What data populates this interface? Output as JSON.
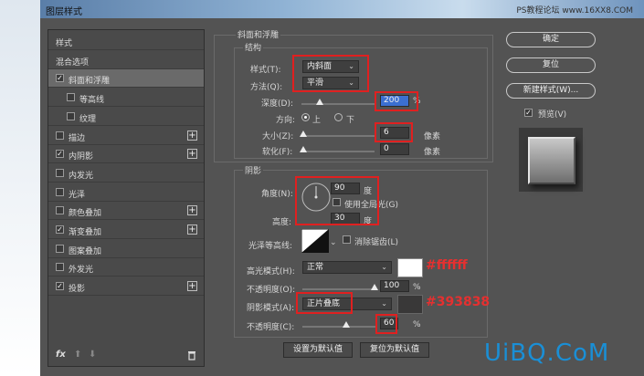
{
  "window": {
    "title": "图层样式",
    "watermark": "PS教程论坛 www.16XX8.COM"
  },
  "styles_list": [
    {
      "label": "样式",
      "checkbox": false,
      "plus": false,
      "checked": false,
      "indent": 0,
      "selected": false
    },
    {
      "label": "混合选项",
      "checkbox": false,
      "plus": false,
      "checked": false,
      "indent": 0,
      "selected": false
    },
    {
      "label": "斜面和浮雕",
      "checkbox": true,
      "plus": false,
      "checked": true,
      "indent": 0,
      "selected": true
    },
    {
      "label": "等高线",
      "checkbox": true,
      "plus": false,
      "checked": false,
      "indent": 1,
      "selected": false
    },
    {
      "label": "纹理",
      "checkbox": true,
      "plus": false,
      "checked": false,
      "indent": 1,
      "selected": false
    },
    {
      "label": "描边",
      "checkbox": true,
      "plus": true,
      "checked": false,
      "indent": 0,
      "selected": false
    },
    {
      "label": "内阴影",
      "checkbox": true,
      "plus": true,
      "checked": true,
      "indent": 0,
      "selected": false
    },
    {
      "label": "内发光",
      "checkbox": true,
      "plus": false,
      "checked": false,
      "indent": 0,
      "selected": false
    },
    {
      "label": "光泽",
      "checkbox": true,
      "plus": false,
      "checked": false,
      "indent": 0,
      "selected": false
    },
    {
      "label": "颜色叠加",
      "checkbox": true,
      "plus": true,
      "checked": false,
      "indent": 0,
      "selected": false
    },
    {
      "label": "渐变叠加",
      "checkbox": true,
      "plus": true,
      "checked": true,
      "indent": 0,
      "selected": false
    },
    {
      "label": "图案叠加",
      "checkbox": true,
      "plus": false,
      "checked": false,
      "indent": 0,
      "selected": false
    },
    {
      "label": "外发光",
      "checkbox": true,
      "plus": false,
      "checked": false,
      "indent": 0,
      "selected": false
    },
    {
      "label": "投影",
      "checkbox": true,
      "plus": true,
      "checked": true,
      "indent": 0,
      "selected": false
    }
  ],
  "footer_icons": {
    "fx": "fx",
    "up": "arrow-up-icon",
    "down": "arrow-down-icon",
    "trash": "trash-icon"
  },
  "bevel": {
    "section_title": "斜面和浮雕",
    "structure_title": "结构",
    "style_label": "样式(T):",
    "style_value": "内斜面",
    "technique_label": "方法(Q):",
    "technique_value": "平滑",
    "depth_label": "深度(D):",
    "depth_value": "200",
    "depth_unit": "%",
    "direction_label": "方向:",
    "direction_up": "上",
    "direction_down": "下",
    "size_label": "大小(Z):",
    "size_value": "6",
    "size_unit": "像素",
    "soften_label": "软化(F):",
    "soften_value": "0",
    "soften_unit": "像素",
    "shading_title": "阴影",
    "angle_label": "角度(N):",
    "angle_value": "90",
    "angle_unit": "度",
    "global_light_label": "使用全局光(G)",
    "altitude_label": "高度:",
    "altitude_value": "30",
    "altitude_unit": "度",
    "gloss_label": "光泽等高线:",
    "antialias_label": "消除锯齿(L)",
    "highlight_mode_label": "高光模式(H):",
    "highlight_mode_value": "正常",
    "highlight_color": "#ffffff",
    "highlight_opacity_label": "不透明度(O):",
    "highlight_opacity_value": "100",
    "highlight_opacity_unit": "%",
    "shadow_mode_label": "阴影模式(A):",
    "shadow_mode_value": "正片叠底",
    "shadow_color": "#393838",
    "shadow_opacity_label": "不透明度(C):",
    "shadow_opacity_value": "60",
    "shadow_opacity_unit": "%",
    "make_default": "设置为默认值",
    "reset_default": "复位为默认值"
  },
  "annotations": {
    "highlight_hex": "#ffffff",
    "shadow_hex": "#393838"
  },
  "buttons": {
    "ok": "确定",
    "reset": "复位",
    "new_style": "新建样式(W)...",
    "preview": "预览(V)"
  },
  "brand": "UiBQ.CoM"
}
